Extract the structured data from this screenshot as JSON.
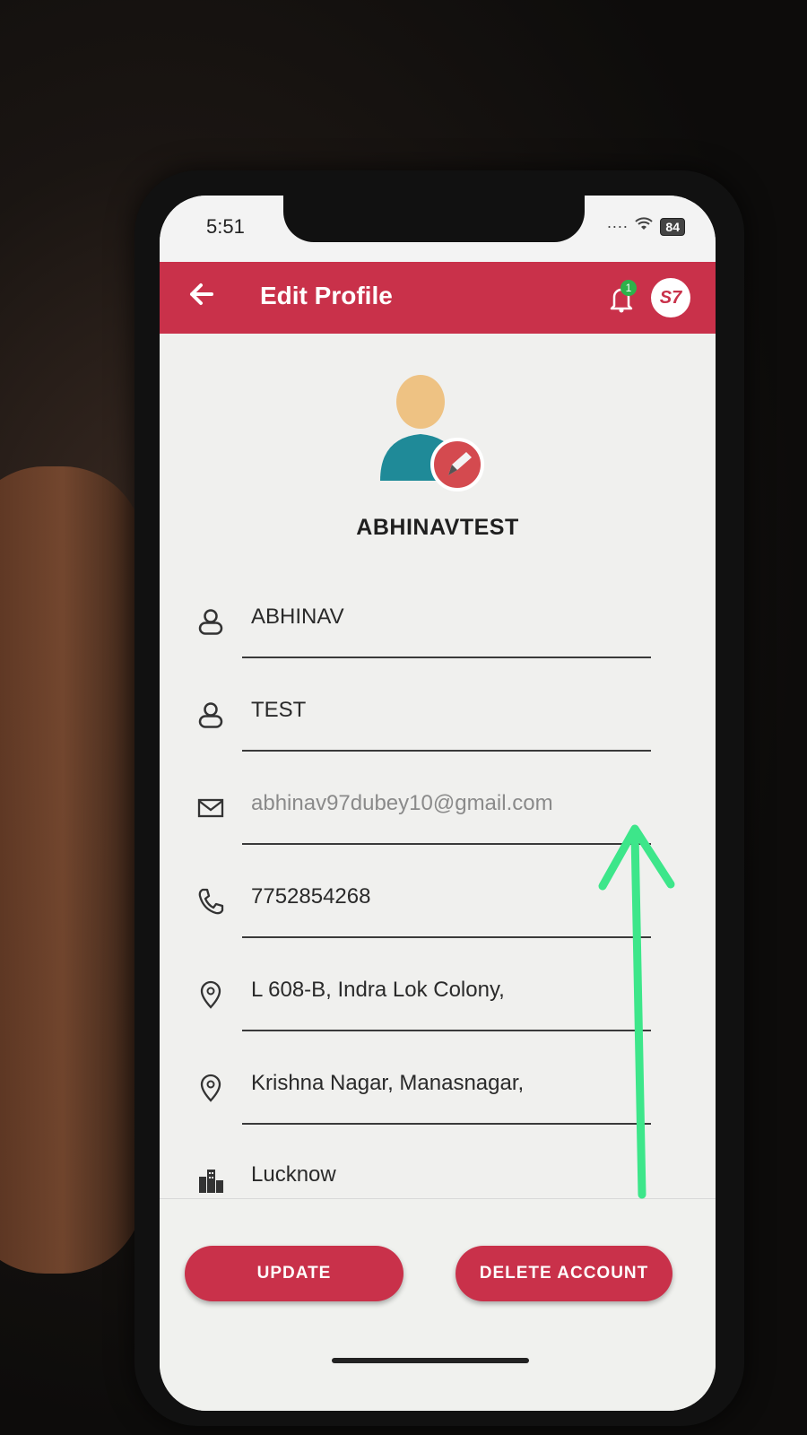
{
  "status": {
    "time": "5:51",
    "battery": "84"
  },
  "header": {
    "title": "Edit Profile",
    "badge": "1",
    "logo": "S7"
  },
  "profile": {
    "username": "ABHINAVTEST"
  },
  "fields": {
    "first_name": "ABHINAV",
    "last_name": "TEST",
    "email": "abhinav97dubey10@gmail.com",
    "phone": "7752854268",
    "address1": "L 608-B, Indra Lok Colony,",
    "address2": "Krishna Nagar, Manasnagar,",
    "city": "Lucknow"
  },
  "actions": {
    "update": "UPDATE",
    "delete": "DELETE ACCOUNT"
  },
  "colors": {
    "accent": "#c9314a",
    "annotation": "#3de68a"
  }
}
